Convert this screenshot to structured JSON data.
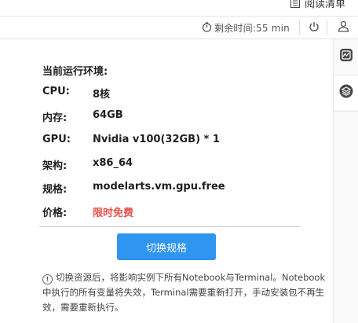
{
  "header": {
    "reading_list_label": "阅读清单",
    "timer_label": "剩余时间:55 min"
  },
  "environment": {
    "title": "当前运行环境:",
    "rows": [
      {
        "key": "CPU:",
        "value": "8核"
      },
      {
        "key": "内存:",
        "value": "64GB"
      },
      {
        "key": "GPU:",
        "value": "Nvidia v100(32GB) * 1"
      },
      {
        "key": "架构:",
        "value": "x86_64"
      },
      {
        "key": "规格:",
        "value": "modelarts.vm.gpu.free"
      },
      {
        "key": "价格:",
        "value": "限时免费"
      }
    ],
    "switch_button_label": "切换规格",
    "note": "切换资源后，将影响实例下所有Notebook与Terminal。Notebook中执行的所有变量将失效，Terminal需要重新打开，手动安装包不再生效，需要重新执行。"
  },
  "colors": {
    "accent": "#2e95f0",
    "price": "#e5524a"
  },
  "icons": [
    "reading-list-icon",
    "timer-icon",
    "power-icon",
    "user-icon",
    "monitor-chart-icon",
    "layers-icon",
    "info-icon"
  ]
}
